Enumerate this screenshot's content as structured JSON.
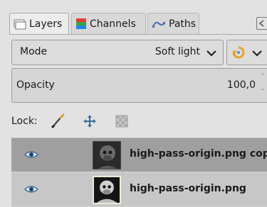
{
  "tabs": [
    {
      "label": "Layers",
      "icon": "layers-icon"
    },
    {
      "label": "Channels",
      "icon": "channels-icon"
    },
    {
      "label": "Paths",
      "icon": "paths-icon"
    }
  ],
  "mode": {
    "label": "Mode",
    "value": "Soft light"
  },
  "opacity": {
    "label": "Opacity",
    "value": "100,0"
  },
  "lock": {
    "label": "Lock:"
  },
  "layers": [
    {
      "name": "high-pass-origin.png copy",
      "visible": true,
      "selected": true
    },
    {
      "name": "high-pass-origin.png",
      "visible": true,
      "selected": false
    }
  ],
  "colors": {
    "channels_red": "#e53935",
    "channels_green": "#43a047",
    "channels_blue": "#1e88e5",
    "composite_accent": "#f0a020",
    "selected_row": "#9f9f9f"
  }
}
